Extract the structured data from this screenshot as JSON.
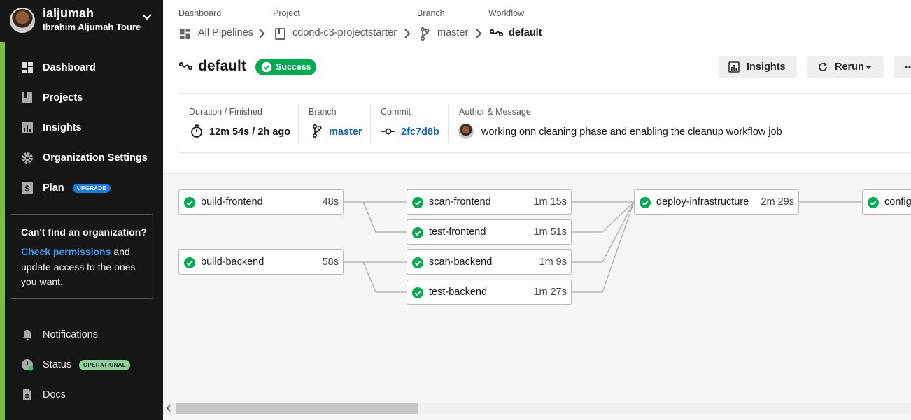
{
  "user": {
    "username": "ialjumah",
    "full_name": "Ibrahim Aljumah Toure"
  },
  "sidebar": {
    "items": [
      {
        "label": "Dashboard",
        "icon": "dashboard-icon"
      },
      {
        "label": "Projects",
        "icon": "projects-icon"
      },
      {
        "label": "Insights",
        "icon": "insights-icon"
      },
      {
        "label": "Organization Settings",
        "icon": "gear-icon"
      },
      {
        "label": "Plan",
        "icon": "dollar-icon",
        "badge": "UPGRADE"
      }
    ],
    "org_box": {
      "title": "Can't find an organization?",
      "link": "Check permissions",
      "text": " and update access to the ones you want."
    },
    "bottom_items": [
      {
        "label": "Notifications",
        "icon": "bell-icon"
      },
      {
        "label": "Status",
        "icon": "status-icon",
        "badge": "OPERATIONAL"
      },
      {
        "label": "Docs",
        "icon": "docs-icon"
      }
    ]
  },
  "breadcrumb": {
    "labels": [
      "Dashboard",
      "Project",
      "Branch",
      "Workflow"
    ],
    "values": [
      "All Pipelines",
      "cdond-c3-projectstarter",
      "master",
      "default"
    ]
  },
  "workflow": {
    "name": "default",
    "status": "Success"
  },
  "actions": {
    "insights": "Insights",
    "rerun": "Rerun"
  },
  "summary": {
    "duration_label": "Duration / Finished",
    "duration_value": "12m 54s / 2h ago",
    "branch_label": "Branch",
    "branch_value": "master",
    "commit_label": "Commit",
    "commit_value": "2fc7d8b",
    "author_label": "Author & Message",
    "message": "working onn cleaning phase and enabling the cleanup workflow job"
  },
  "jobs": [
    {
      "name": "build-frontend",
      "duration": "48s"
    },
    {
      "name": "build-backend",
      "duration": "58s"
    },
    {
      "name": "scan-frontend",
      "duration": "1m 15s"
    },
    {
      "name": "test-frontend",
      "duration": "1m 51s"
    },
    {
      "name": "scan-backend",
      "duration": "1m 9s"
    },
    {
      "name": "test-backend",
      "duration": "1m 27s"
    },
    {
      "name": "deploy-infrastructure",
      "duration": "2m 29s"
    },
    {
      "name": "configure-infrastructure",
      "duration": ""
    }
  ],
  "colors": {
    "sidebar": "#161616",
    "accent": "#77c13f",
    "success": "#04aa51",
    "link": "#1066c0",
    "upgrade": "#1f7ae0"
  }
}
